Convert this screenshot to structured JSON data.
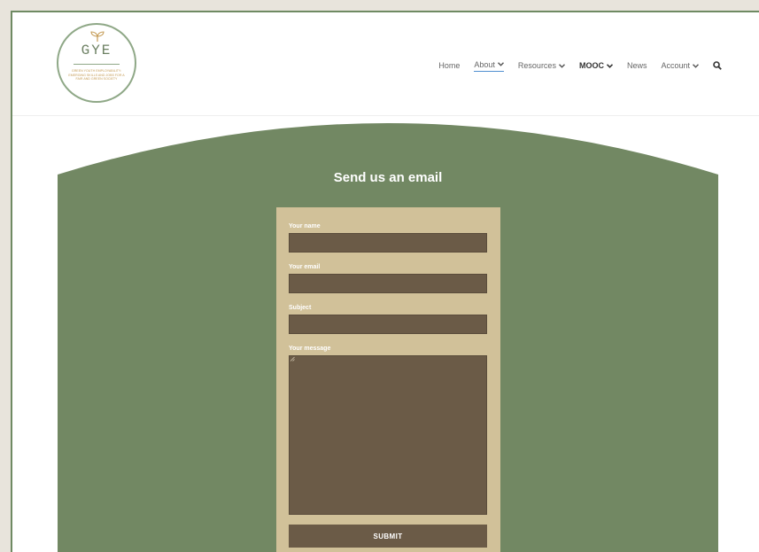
{
  "logo": {
    "letters": "GYE",
    "tagline": "Green youth employability: emerging skills and jobs for a fair and green society"
  },
  "nav": {
    "items": [
      {
        "label": "Home"
      },
      {
        "label": "About",
        "dropdown": true
      },
      {
        "label": "Resources",
        "dropdown": true
      },
      {
        "label": "MOOC",
        "dropdown": true
      },
      {
        "label": "News"
      },
      {
        "label": "Account",
        "dropdown": true
      }
    ],
    "search_icon": "search-icon"
  },
  "form": {
    "title": "Send us an email",
    "fields": {
      "name_label": "Your name",
      "email_label": "Your email",
      "subject_label": "Subject",
      "message_label": "Your message"
    },
    "submit_label": "SUBMIT"
  },
  "colors": {
    "green": "#728863",
    "card": "#d1c199",
    "field": "#6b5b47",
    "accent_underline": "#4f8fd0"
  }
}
